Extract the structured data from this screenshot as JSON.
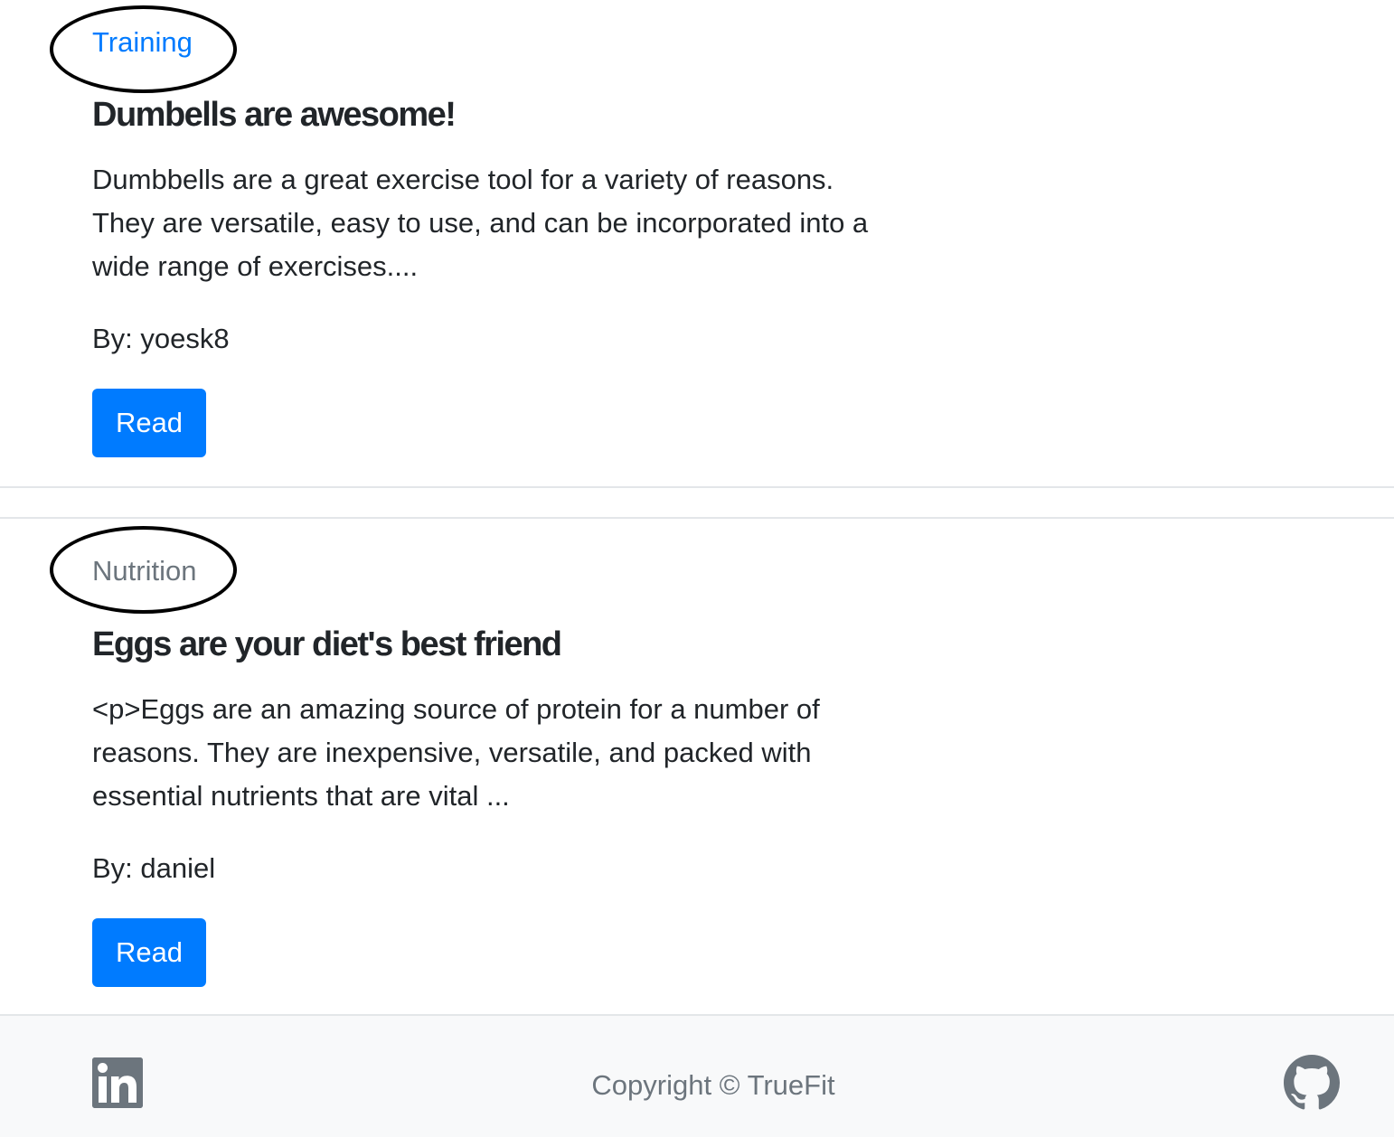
{
  "posts": [
    {
      "category": "Training",
      "category_color": "#007bff",
      "title": "Dumbells are awesome!",
      "excerpt_lines": [
        "Dumbbells are a great exercise tool for a variety of reasons.",
        "They are versatile, easy to use, and can be incorporated into a",
        "wide range of exercises...."
      ],
      "byline": "By: yoesk8",
      "button_label": "Read"
    },
    {
      "category": "Nutrition",
      "category_color": "#6c757d",
      "title": "Eggs are your diet's best friend",
      "excerpt_lines": [
        "<p>Eggs are an amazing source of protein for a number of",
        "reasons. They are inexpensive, versatile, and packed with",
        "essential nutrients that are vital ..."
      ],
      "byline": "By: daniel",
      "button_label": "Read"
    }
  ],
  "footer": {
    "copyright": "Copyright © TrueFit",
    "left_icon": "linkedin-icon",
    "right_icon": "github-icon"
  },
  "colors": {
    "primary": "#007bff",
    "muted": "#6c757d",
    "text": "#212529",
    "footer_bg": "#f8f9fa",
    "annotation": "#000000"
  }
}
